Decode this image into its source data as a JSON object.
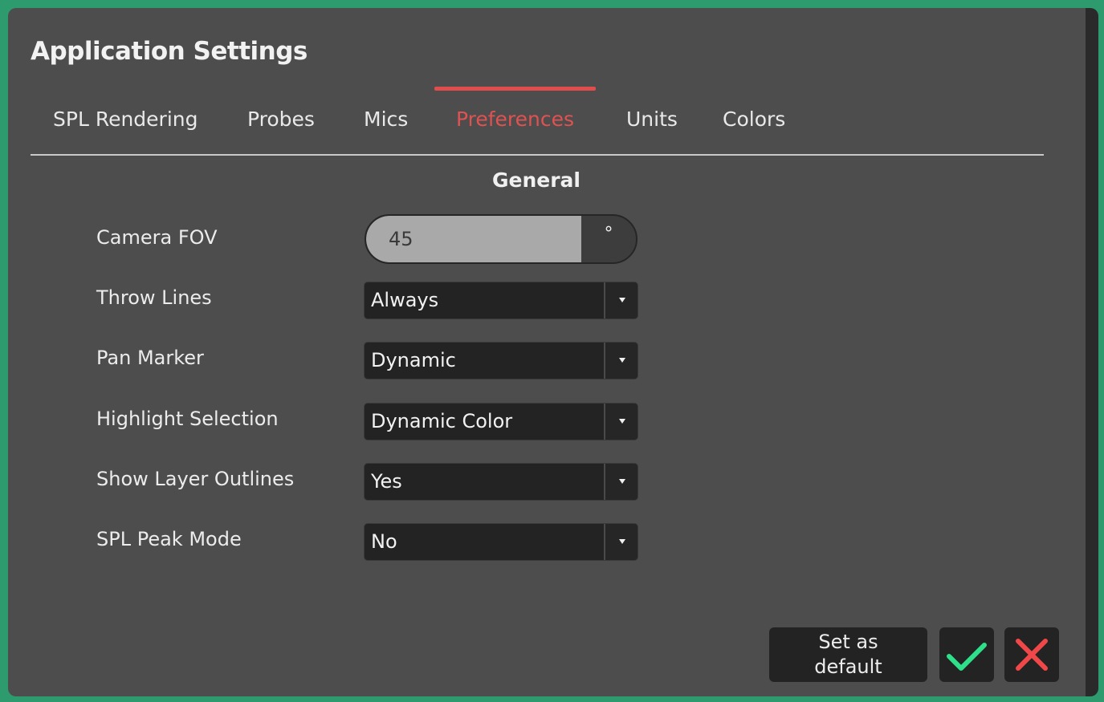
{
  "dialog": {
    "title": "Application Settings"
  },
  "tabs": [
    {
      "label": "SPL Rendering",
      "active": false
    },
    {
      "label": "Probes",
      "active": false
    },
    {
      "label": "Mics",
      "active": false
    },
    {
      "label": "Preferences",
      "active": true
    },
    {
      "label": "Units",
      "active": false
    },
    {
      "label": "Colors",
      "active": false
    }
  ],
  "section": {
    "title": "General"
  },
  "settings": {
    "camera_fov": {
      "label": "Camera FOV",
      "value": "45",
      "unit": "°"
    },
    "throw_lines": {
      "label": "Throw Lines",
      "value": "Always"
    },
    "pan_marker": {
      "label": "Pan Marker",
      "value": "Dynamic"
    },
    "highlight_selection": {
      "label": "Highlight Selection",
      "value": "Dynamic Color"
    },
    "show_layer_outlines": {
      "label": "Show Layer Outlines",
      "value": "Yes"
    },
    "spl_peak_mode": {
      "label": "SPL Peak Mode",
      "value": "No"
    }
  },
  "footer": {
    "set_default_line1": "Set as",
    "set_default_line2": "default",
    "confirm_icon": "checkmark-icon",
    "cancel_icon": "close-icon"
  },
  "colors": {
    "accent": "#e14c4c",
    "confirm": "#2ee08a",
    "cancel": "#f04848",
    "panel": "#4d4d4d",
    "control": "#232323"
  }
}
